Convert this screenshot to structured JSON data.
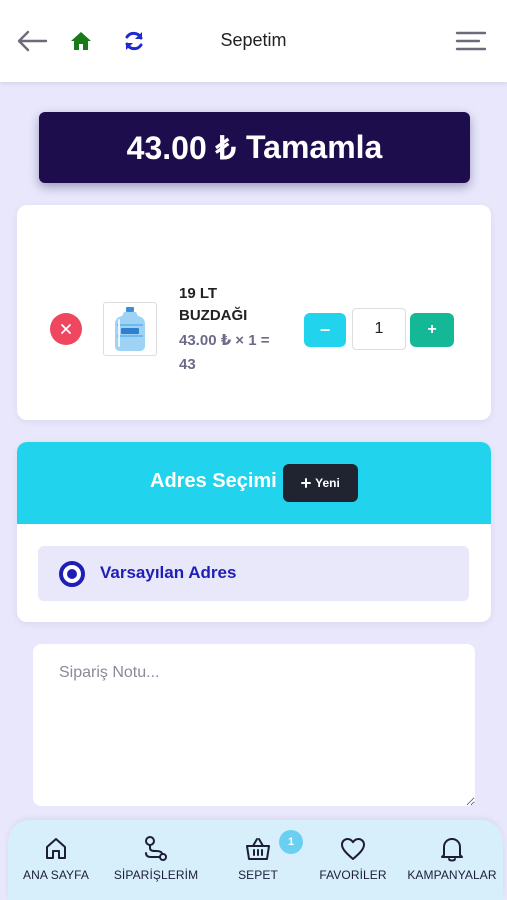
{
  "header": {
    "title": "Sepetim",
    "back_icon": "arrow-left-icon",
    "home_icon": "home-icon",
    "refresh_icon": "refresh-icon",
    "menu_icon": "hamburger-menu-icon"
  },
  "checkout": {
    "amount": "43.00 ₺",
    "label": "Tamamla"
  },
  "cart": {
    "items": [
      {
        "name": "19 LT BUZDAĞI",
        "price_line": "43.00 ₺ × 1 = 43",
        "quantity": "1",
        "minus_label": "−",
        "plus_label": "+"
      }
    ]
  },
  "address": {
    "title": "Adres Seçimi",
    "new_label": "Yeni",
    "options": [
      {
        "label": "Varsayılan Adres",
        "selected": true
      }
    ]
  },
  "note": {
    "placeholder": "Sipariş Notu..."
  },
  "nav": {
    "items": [
      {
        "label": "ANA SAYFA",
        "icon": "home-outline-icon"
      },
      {
        "label": "SİPARİŞLERİM",
        "icon": "route-icon"
      },
      {
        "label": "SEPET",
        "icon": "basket-icon",
        "badge": "1"
      },
      {
        "label": "FAVORİLER",
        "icon": "heart-icon"
      },
      {
        "label": "KAMPANYALAR",
        "icon": "bell-icon"
      }
    ]
  },
  "colors": {
    "background": "#e8e7fb",
    "primary_dark": "#1d0d4d",
    "cyan": "#22d3ee",
    "green": "#14b897",
    "red": "#ef4760",
    "radio_blue": "#1f1fb6",
    "nav_bg": "#d6effa"
  }
}
